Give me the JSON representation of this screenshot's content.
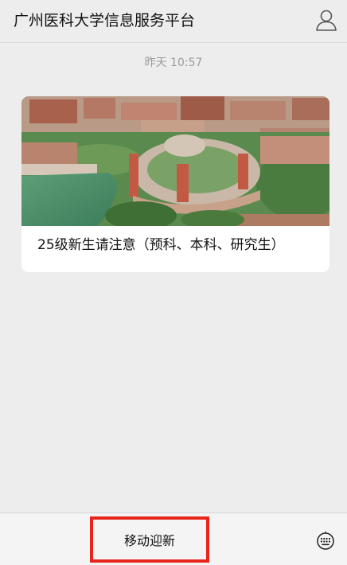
{
  "header": {
    "title": "广州医科大学信息服务平台",
    "profile_icon": "person-icon"
  },
  "chat": {
    "timestamp": "昨天 10:57",
    "article": {
      "image_icon": "campus-aerial-photo",
      "title": "25级新生请注意（预科、本科、研究生）"
    }
  },
  "footer": {
    "menu_label": "移动迎新",
    "keyboard_icon": "keyboard-icon",
    "highlight_color": "#e8251c"
  }
}
